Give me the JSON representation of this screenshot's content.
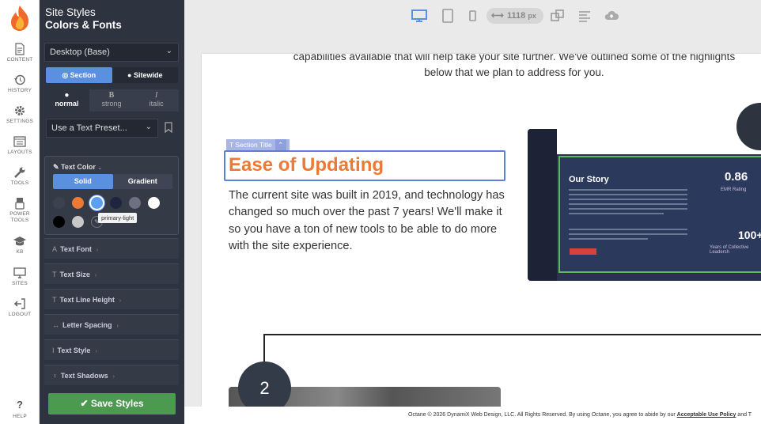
{
  "rail": {
    "items": [
      {
        "label": "CONTENT",
        "icon": "document-icon"
      },
      {
        "label": "HISTORY",
        "icon": "history-icon"
      },
      {
        "label": "SETTINGS",
        "icon": "gear-icon"
      },
      {
        "label": "LAYOUTS",
        "icon": "layout-icon"
      },
      {
        "label": "TOOLS",
        "icon": "wrench-icon"
      },
      {
        "label": "POWER",
        "label2": "TOOLS",
        "icon": "power-tools-icon"
      },
      {
        "label": "KB",
        "icon": "graduation-cap-icon"
      },
      {
        "label": "SITES",
        "icon": "monitor-icon"
      },
      {
        "label": "LOGOUT",
        "icon": "logout-icon"
      }
    ],
    "help": "HELP"
  },
  "panel": {
    "title": "Site Styles",
    "subtitle": "Colors & Fonts",
    "device": "Desktop (Base)",
    "scope": {
      "section": "Section",
      "sitewide": "Sitewide"
    },
    "weights": {
      "normal": "normal",
      "strong": "strong",
      "italic": "italic",
      "strong_glyph": "B",
      "italic_glyph": "I"
    },
    "preset_placeholder": "Use a Text Preset...",
    "text_color": {
      "label": "Text Color",
      "solid": "Solid",
      "gradient": "Gradient",
      "tooltip": "primary-light",
      "swatches_row1": [
        "#3d4250",
        "#ec7a35",
        "#5b9ff0",
        "#1e2540",
        "#6c7080",
        "#ffffff"
      ],
      "swatches_row2": [
        "#000000",
        "#c8c8c8"
      ]
    },
    "sections": [
      {
        "label": "Text Font",
        "icon": "A"
      },
      {
        "label": "Text Size",
        "icon": "T"
      },
      {
        "label": "Text Line Height",
        "icon": "T"
      },
      {
        "label": "Letter Spacing",
        "icon": "↔"
      },
      {
        "label": "Text Style",
        "icon": "I"
      },
      {
        "label": "Text Shadows",
        "icon": "♀"
      }
    ],
    "save": "Save Styles"
  },
  "toolbar": {
    "width_value": "1118",
    "width_unit": "px",
    "accent": "#5b8fe0"
  },
  "canvas": {
    "intro_line1": "capabilities available that will help take your site further. We've outlined some of the highlights",
    "intro_line2": "below that we plan to address for you.",
    "section_tag": "Section Title",
    "title": "Ease of Updating",
    "body": "The current site was built in 2019, and technology has changed so much over the past 7 years! We'll make it so you have a ton of new tools to be able to do more with the site experience.",
    "mock": {
      "heading": "Our Story",
      "stat1": "0.86",
      "stat1_caption": "EMR Rating",
      "stat2": "100+",
      "stat2_caption": "Years of Collective Leadersh"
    },
    "step_number": "2"
  },
  "footer": {
    "text": "Octane © 2026 DynamiX Web Design, LLC. All Rights Reserved. By using Octane, you agree to abide by our ",
    "link": "Acceptable Use Policy",
    "tail": " and T"
  }
}
